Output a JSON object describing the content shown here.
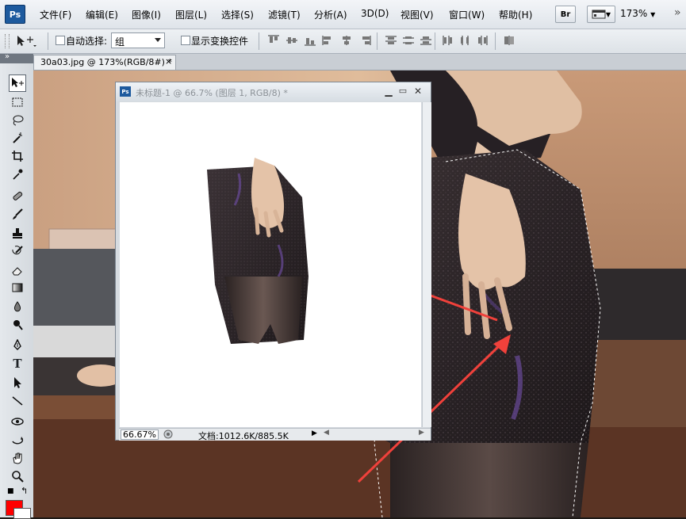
{
  "app": {
    "logo": "Ps"
  },
  "menu": [
    "文件(F)",
    "编辑(E)",
    "图像(I)",
    "图层(L)",
    "选择(S)",
    "滤镜(T)",
    "分析(A)",
    "3D(D)",
    "视图(V)",
    "窗口(W)",
    "帮助(H)"
  ],
  "menubar_right": {
    "bridge_label": "Br",
    "zoom": "173%"
  },
  "options": {
    "auto_select_label": "自动选择:",
    "auto_select_value": "组",
    "show_transform_label": "显示变换控件"
  },
  "tab": {
    "title": "30a03.jpg @ 173%(RGB/8#) *",
    "close": "×"
  },
  "doc_window": {
    "title": "未标题-1 @ 66.7% (图层 1, RGB/8) *",
    "status_zoom": "66.67%",
    "status_doc": "文档:1012.6K/885.5K"
  },
  "colors": {
    "foreground": "#ff0000",
    "background": "#ffffff",
    "arrow": "#f0413b"
  },
  "tools": [
    "move-tool-icon",
    "marquee-tool-icon",
    "lasso-tool-icon",
    "magic-wand-icon",
    "crop-tool-icon",
    "eyedropper-icon",
    "healing-brush-icon",
    "brush-tool-icon",
    "clone-stamp-icon",
    "history-brush-icon",
    "eraser-icon",
    "gradient-tool-icon",
    "blur-tool-icon",
    "dodge-tool-icon",
    "pen-tool-icon",
    "type-tool-icon",
    "path-select-icon",
    "line-tool-icon",
    "3d-rotate-icon",
    "3d-orbit-icon",
    "hand-tool-icon",
    "zoom-tool-icon"
  ]
}
